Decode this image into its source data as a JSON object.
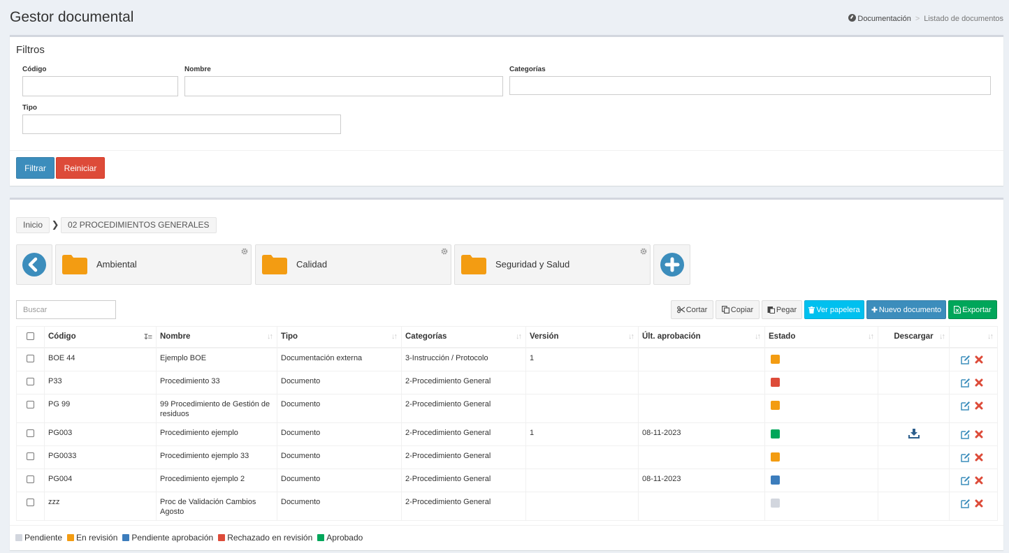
{
  "header": {
    "title": "Gestor documental",
    "breadcrumb": {
      "home": "Documentación",
      "current": "Listado de documentos"
    }
  },
  "filters": {
    "title": "Filtros",
    "codigo_label": "Código",
    "nombre_label": "Nombre",
    "categorias_label": "Categorías",
    "tipo_label": "Tipo",
    "filtrar": "Filtrar",
    "reiniciar": "Reiniciar"
  },
  "folders": {
    "crumb_home": "Inicio",
    "crumb_current": "02 PROCEDIMIENTOS GENERALES",
    "items": [
      {
        "label": "Ambiental"
      },
      {
        "label": "Calidad"
      },
      {
        "label": "Seguridad y Salud"
      }
    ]
  },
  "toolbar": {
    "search_placeholder": "Buscar",
    "cortar": "Cortar",
    "copiar": "Copiar",
    "pegar": "Pegar",
    "papelera": "Ver papelera",
    "nuevo": "Nuevo documento",
    "exportar": "Exportar"
  },
  "table": {
    "headers": {
      "codigo": "Código",
      "nombre": "Nombre",
      "tipo": "Tipo",
      "categorias": "Categorías",
      "version": "Versión",
      "aprobacion": "Últ. aprobación",
      "estado": "Estado",
      "descargar": "Descargar"
    },
    "rows": [
      {
        "codigo": "BOE 44",
        "nombre": "Ejemplo BOE",
        "tipo": "Documentación externa",
        "categorias": "3-Instrucción / Protocolo",
        "version": "1",
        "aprobacion": "",
        "estado": "En revisión",
        "estado_color": "#f39c12",
        "descargable": false
      },
      {
        "codigo": "P33",
        "nombre": "Procedimiento 33",
        "tipo": "Documento",
        "categorias": "2-Procedimiento General",
        "version": "",
        "aprobacion": "",
        "estado": "Rechazado en revisión",
        "estado_color": "#dd4b39",
        "descargable": false
      },
      {
        "codigo": "PG 99",
        "nombre": "99 Procedimiento de Gestión de residuos",
        "tipo": "Documento",
        "categorias": "2-Procedimiento General",
        "version": "",
        "aprobacion": "",
        "estado": "En revisión",
        "estado_color": "#f39c12",
        "descargable": false
      },
      {
        "codigo": "PG003",
        "nombre": "Procedimiento ejemplo",
        "tipo": "Documento",
        "categorias": "2-Procedimiento General",
        "version": "1",
        "aprobacion": "08-11-2023",
        "estado": "Aprobado",
        "estado_color": "#00a65a",
        "descargable": true
      },
      {
        "codigo": "PG0033",
        "nombre": "Procedimiento ejemplo 33",
        "tipo": "Documento",
        "categorias": "2-Procedimiento General",
        "version": "",
        "aprobacion": "",
        "estado": "En revisión",
        "estado_color": "#f39c12",
        "descargable": false
      },
      {
        "codigo": "PG004",
        "nombre": "Procedimiento ejemplo 2",
        "tipo": "Documento",
        "categorias": "2-Procedimiento General",
        "version": "",
        "aprobacion": "08-11-2023",
        "estado": "Pendiente aprobación",
        "estado_color": "#3c7dbc",
        "descargable": false
      },
      {
        "codigo": "zzz",
        "nombre": "Proc de Validación Cambios Agosto",
        "tipo": "Documento",
        "categorias": "2-Procedimiento General",
        "version": "",
        "aprobacion": "",
        "estado": "Pendiente",
        "estado_color": "#d2d6de",
        "descargable": false
      }
    ]
  },
  "legend": [
    {
      "label": "Pendiente",
      "color": "#d2d6de"
    },
    {
      "label": "En revisión",
      "color": "#f39c12"
    },
    {
      "label": "Pendiente aprobación",
      "color": "#3c7dbc"
    },
    {
      "label": "Rechazado en revisión",
      "color": "#dd4b39"
    },
    {
      "label": "Aprobado",
      "color": "#00a65a"
    }
  ]
}
